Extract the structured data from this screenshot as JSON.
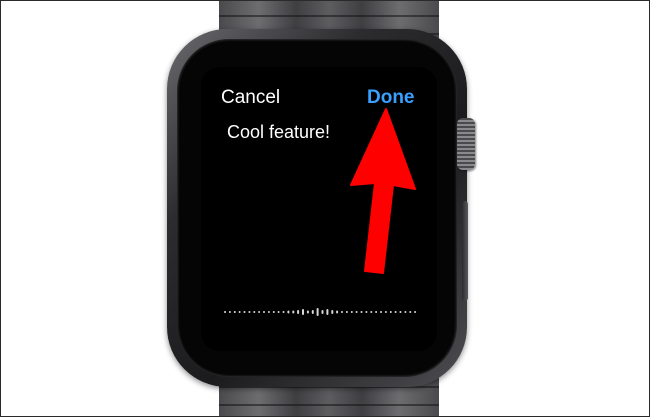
{
  "dictation": {
    "cancel_label": "Cancel",
    "done_label": "Done",
    "text": "Cool feature!"
  },
  "colors": {
    "done_accent": "#3aa0ff",
    "arrow": "#ff0000",
    "screen_bg": "#000000"
  },
  "icons": {
    "annotation_arrow": "red-arrow-icon",
    "waveform": "audio-waveform-icon",
    "crown": "digital-crown-icon"
  }
}
